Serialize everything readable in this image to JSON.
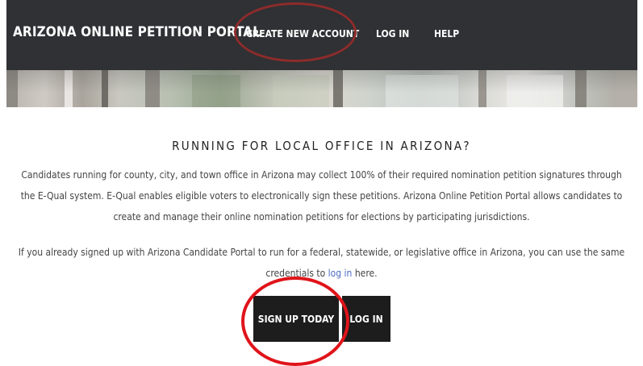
{
  "header": {
    "brand": "ARIZONA ONLINE PETITION PORTAL",
    "nav": {
      "create_account": "CREATE NEW ACCOUNT",
      "log_in": "LOG IN",
      "help": "HELP"
    }
  },
  "main": {
    "heading": "RUNNING FOR LOCAL OFFICE IN ARIZONA?",
    "paragraph_1": "Candidates running for county, city, and town office in Arizona may collect 100% of their required nomination petition signatures through the E-Qual system. E-Qual enables eligible voters to electronically sign these petitions. Arizona Online Petition Portal allows candidates to create and manage their online nomination petitions for elections by participating jurisdictions.",
    "paragraph_2": {
      "before_link": "If you already signed up with Arizona Candidate Portal to run for a federal, statewide, or legislative office in Arizona, you can use the same credentials to ",
      "link": "log in",
      "after_link": " here."
    },
    "buttons": {
      "sign_up": "SIGN UP TODAY",
      "log_in": "LOG IN"
    }
  },
  "colors": {
    "header_bg": "#2f3134",
    "button_bg": "#1d1d1d",
    "link": "#4b6cc1",
    "annotation": "#e0141a"
  }
}
